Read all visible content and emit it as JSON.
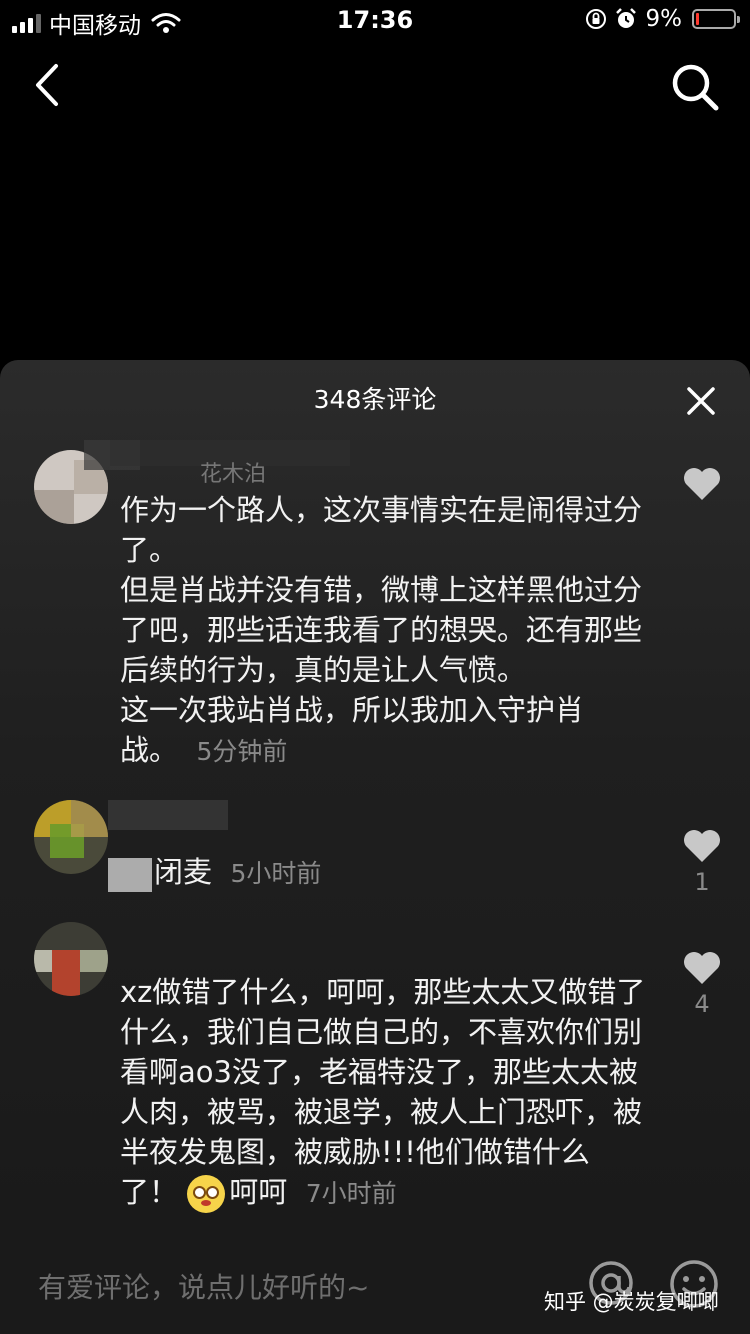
{
  "status_bar": {
    "carrier": "中国移动",
    "time": "17:36",
    "battery_percent": "9%",
    "battery_level": 0.09,
    "battery_color": "#ff3b30",
    "icons": [
      "signal-icon",
      "wifi-icon",
      "orientation-lock-icon",
      "alarm-icon",
      "battery-icon"
    ]
  },
  "nav": {
    "back_icon": "chevron-left-icon",
    "search_icon": "search-icon"
  },
  "sheet": {
    "title": "348条评论",
    "close_icon": "close-icon"
  },
  "comments": [
    {
      "username": "花木泊",
      "paragraphs": [
        "作为一个路人，这次事情实在是闹得过分了。",
        "但是肖战并没有错，微博上这样黑他过分了吧，那些话连我看了的想哭。还有那些后续的行为，真的是让人气愤。",
        "这一次我站肖战，所以我加入守护肖战。"
      ],
      "time": "5分钟前",
      "likes": ""
    },
    {
      "username": "",
      "text": "闭麦",
      "time": "5小时前",
      "likes": "1"
    },
    {
      "username": "",
      "text": "xz做错了什么，呵呵，那些太太又做错了什么，我们自己做自己的，不喜欢你们别看啊ao3没了，老福特没了，那些太太被人肉，被骂，被退学，被人上门恐吓，被半夜发鬼图，被威胁!!!他们做错什么了！",
      "emoji_icon": "flushed-face-emoji-icon",
      "text_after_emoji": "呵呵",
      "time": "7小时前",
      "likes": "4"
    }
  ],
  "input_bar": {
    "placeholder": "有爱评论，说点儿好听的~",
    "at_icon": "at-sign-icon",
    "emoji_icon": "emoji-face-icon"
  },
  "watermark": "知乎 @炭炭复唧唧"
}
